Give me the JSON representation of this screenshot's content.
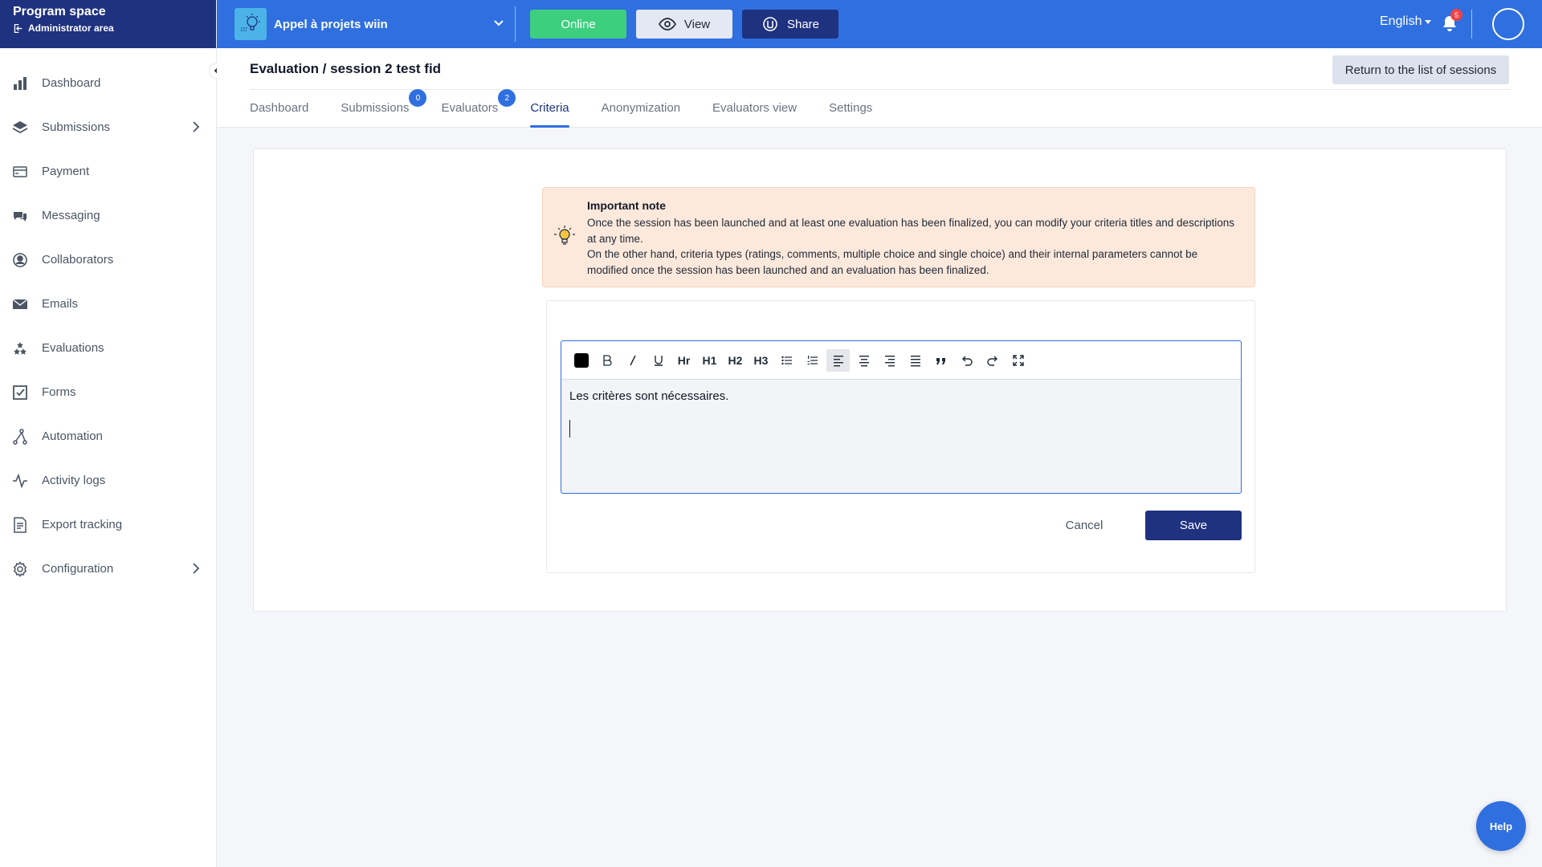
{
  "brand": {
    "title": "Program space",
    "admin": "Administrator area"
  },
  "sidebar": {
    "items": [
      {
        "label": "Dashboard",
        "icon": "bar-chart-icon"
      },
      {
        "label": "Submissions",
        "icon": "layers-icon",
        "has_children": true
      },
      {
        "label": "Payment",
        "icon": "credit-card-icon"
      },
      {
        "label": "Messaging",
        "icon": "chat-icon"
      },
      {
        "label": "Collaborators",
        "icon": "user-circle-icon"
      },
      {
        "label": "Emails",
        "icon": "envelope-icon"
      },
      {
        "label": "Evaluations",
        "icon": "stars-icon"
      },
      {
        "label": "Forms",
        "icon": "checkbox-icon"
      },
      {
        "label": "Automation",
        "icon": "workflow-icon"
      },
      {
        "label": "Activity logs",
        "icon": "activity-icon"
      },
      {
        "label": "Export tracking",
        "icon": "document-icon"
      },
      {
        "label": "Configuration",
        "icon": "gear-icon",
        "has_children": true
      }
    ]
  },
  "topbar": {
    "project_name": "Appel à projets wiin",
    "online_label": "Online",
    "view_label": "View",
    "share_label": "Share",
    "language": "English",
    "notification_count": "5"
  },
  "page": {
    "title": "Evaluation / session 2 test fid",
    "return_label": "Return to the list of sessions",
    "tabs": [
      {
        "label": "Dashboard",
        "active": false
      },
      {
        "label": "Submissions",
        "badge": "0",
        "active": false
      },
      {
        "label": "Evaluators",
        "badge": "2",
        "active": false
      },
      {
        "label": "Criteria",
        "active": true
      },
      {
        "label": "Anonymization",
        "active": false
      },
      {
        "label": "Evaluators view",
        "active": false
      },
      {
        "label": "Settings",
        "active": false
      }
    ]
  },
  "note": {
    "heading": "Important note",
    "line1": "Once the session has been launched and at least one evaluation has been finalized, you can modify your criteria titles and descriptions at any time.",
    "line2": "On the other hand, criteria types (ratings, comments, multiple choice and single choice) and their internal parameters cannot be modified once the session has been launched and an evaluation has been finalized."
  },
  "editor": {
    "toolbar": {
      "bold": "B",
      "hr": "Hr",
      "h1": "H1",
      "h2": "H2",
      "h3": "H3"
    },
    "content": "Les critères sont nécessaires.",
    "swatch_color": "#000000"
  },
  "actions": {
    "cancel_label": "Cancel",
    "save_label": "Save"
  },
  "help_label": "Help",
  "colors": {
    "primary": "#2f6fe0",
    "navy": "#1f3280",
    "online": "#3ecf7e",
    "note_bg": "#fde9dc"
  }
}
